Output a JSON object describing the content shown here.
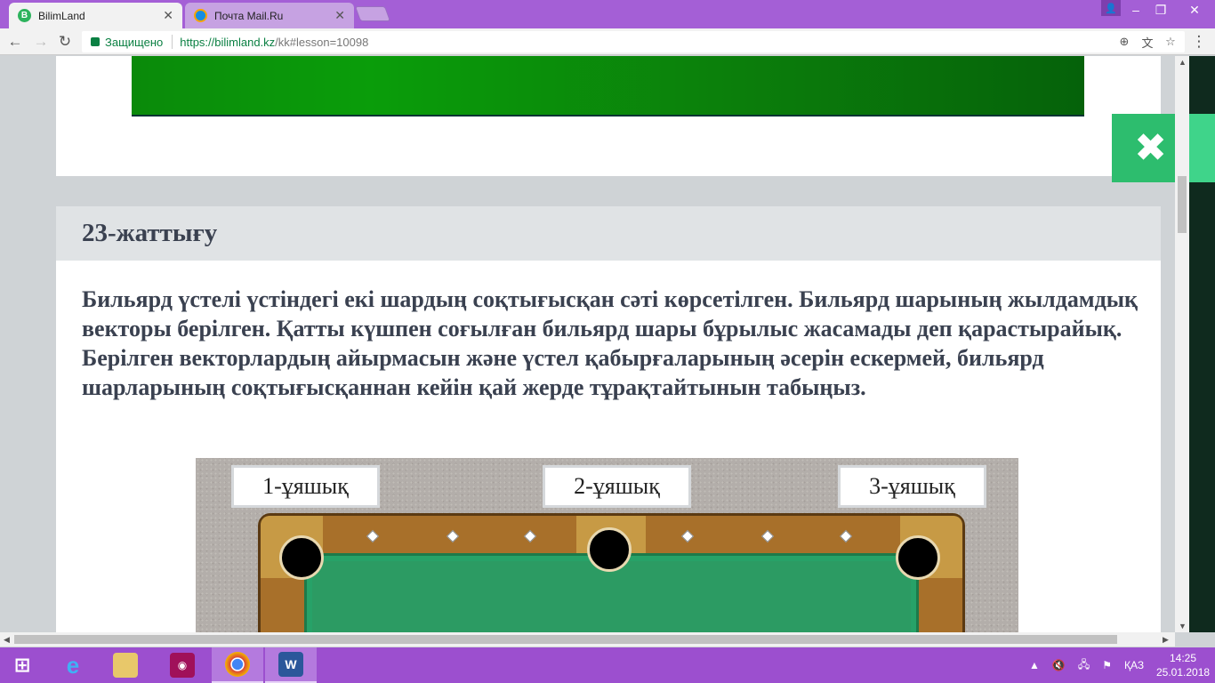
{
  "browser": {
    "tabs": [
      {
        "label": "BilimLand",
        "icon": "bilimland-favicon",
        "active": true
      },
      {
        "label": "Почта Mail.Ru",
        "icon": "mailru-favicon",
        "active": false
      }
    ],
    "address_bar": {
      "secure_label": "Защищено",
      "url_host": "https://bilimland.kz",
      "url_path": "/kk#lesson=10098"
    }
  },
  "exercise": {
    "title": "23-жаттығу",
    "text": "Бильярд үстелі үстіндегі екі шардың соқтығысқан сәті көрсетілген. Бильярд шарының жылдамдық векторы берілген. Қатты күшпен соғылған бильярд шары бұрылыс жасамады деп қарастырайық. Берілген векторлардың айырмасын және үстел қабырғаларының әсерін ескермей, бильярд шарларының соқтығысқаннан кейін қай жерде тұрақтайтынын табыңыз.",
    "pockets": [
      {
        "label": "1-ұяшық"
      },
      {
        "label": "2-ұяшық"
      },
      {
        "label": "3-ұяшық"
      }
    ]
  },
  "colors": {
    "banner_green": "#0a8a0a",
    "close_green": "#2dbd6e",
    "taskbar_purple": "#9c4fcf",
    "titlebar_purple": "#a45fd6"
  },
  "taskbar": {
    "language": "ҚАЗ",
    "time": "14:25",
    "date": "25.01.2018",
    "apps": [
      "start-icon",
      "ie-icon",
      "explorer-icon",
      "camera-icon",
      "chrome-icon",
      "word-icon"
    ]
  }
}
